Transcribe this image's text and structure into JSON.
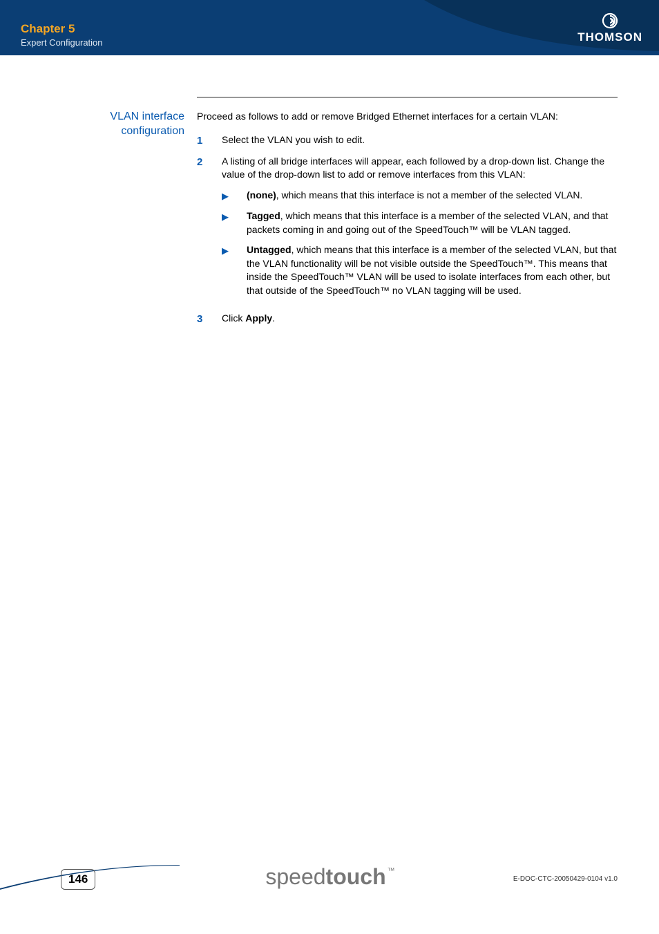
{
  "header": {
    "chapter": "Chapter 5",
    "subtitle": "Expert Configuration",
    "brand": "THOMSON"
  },
  "section": {
    "side_label_line1": "VLAN interface",
    "side_label_line2": "configuration",
    "intro": "Proceed as follows to add or remove Bridged Ethernet interfaces for a certain VLAN:",
    "steps": [
      {
        "num": "1",
        "text": "Select the VLAN you wish to edit."
      },
      {
        "num": "2",
        "text": "A listing of all bridge interfaces will appear, each followed by a drop-down list. Change the value of the drop-down list to add or remove interfaces from this VLAN:",
        "bullets": [
          {
            "bold": "(none)",
            "rest": ", which means that this interface is not a member of the selected VLAN."
          },
          {
            "bold": "Tagged",
            "rest": ", which means that this interface is a member of the selected VLAN, and that packets coming in and going out of the SpeedTouch™ will be VLAN tagged."
          },
          {
            "bold": "Untagged",
            "rest": ", which means that this interface is a member of the selected VLAN, but that the VLAN functionality will be not visible outside the SpeedTouch™. This means that inside the SpeedTouch™ VLAN will be used to isolate interfaces from each other, but that outside of the SpeedTouch™ no VLAN tagging will be used."
          }
        ]
      },
      {
        "num": "3",
        "text_prefix": "Click ",
        "text_bold": "Apply",
        "text_suffix": "."
      }
    ]
  },
  "footer": {
    "page": "146",
    "logo_light": "speed",
    "logo_heavy": "touch",
    "logo_tm": "™",
    "docref": "E-DOC-CTC-20050429-0104 v1.0"
  }
}
